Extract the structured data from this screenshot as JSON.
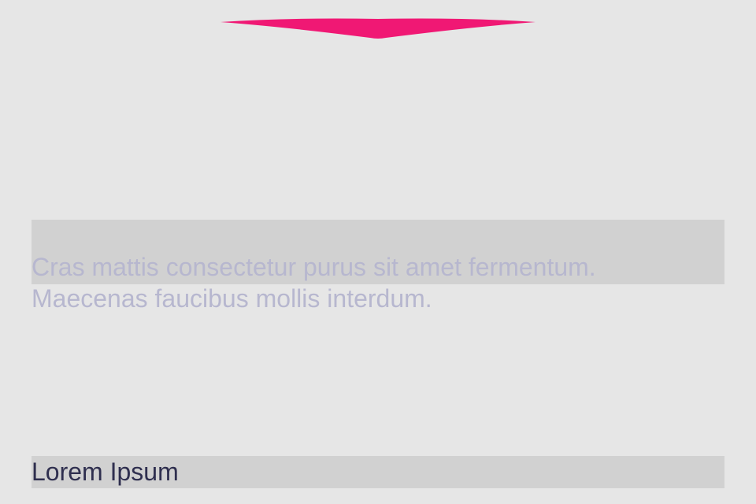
{
  "colors": {
    "background": "#e6e6e6",
    "panel": "#d1d1d1",
    "accent": "#f01874",
    "description_text": "#b7b7cf",
    "title_text": "#2f2f4f"
  },
  "top_indicator": {
    "icon": "chevron-down-icon"
  },
  "content": {
    "description_line_1": "Cras mattis consectetur purus sit amet fermentum.",
    "description_line_2": "Maecenas faucibus mollis interdum.",
    "title": "Lorem Ipsum"
  }
}
